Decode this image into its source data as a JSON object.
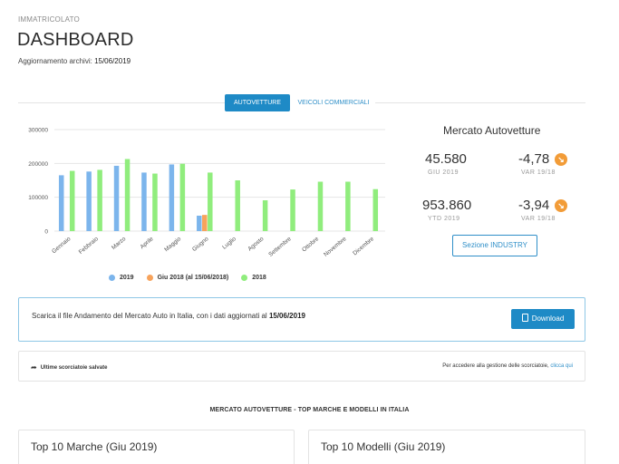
{
  "header": {
    "eyebrow": "IMMATRICOLATO",
    "title": "DASHBOARD",
    "updated_label": "Aggiornamento archivi:",
    "updated_date": "15/06/2019"
  },
  "tabs": [
    {
      "label": "AUTOVETTURE",
      "active": true
    },
    {
      "label": "VEICOLI COMMERCIALI",
      "active": false
    }
  ],
  "chart_data": {
    "type": "bar",
    "categories": [
      "Gennaio",
      "Febbraio",
      "Marzo",
      "Aprile",
      "Maggio",
      "Giugno",
      "Luglio",
      "Agosto",
      "Settembre",
      "Ottobre",
      "Novembre",
      "Dicembre"
    ],
    "yticks": [
      "0",
      "100000",
      "200000",
      "300000"
    ],
    "ylim": [
      0,
      300000
    ],
    "series": [
      {
        "name": "2019",
        "color": "#7cb5ec",
        "values": [
          165000,
          176000,
          193000,
          173000,
          197000,
          45580,
          null,
          null,
          null,
          null,
          null,
          null
        ]
      },
      {
        "name": "Giu 2018 (al 15/06/2018)",
        "color": "#f7a35c",
        "values": [
          null,
          null,
          null,
          null,
          null,
          47800,
          null,
          null,
          null,
          null,
          null,
          null
        ]
      },
      {
        "name": "2018",
        "color": "#90ed7d",
        "values": [
          178000,
          181000,
          213000,
          170000,
          199000,
          173000,
          150000,
          91000,
          123000,
          146000,
          146000,
          124000
        ]
      }
    ]
  },
  "market": {
    "title": "Mercato Autovetture",
    "month_value": "45.580",
    "month_label": "GIU 2019",
    "month_var": "-4,78",
    "month_var_label": "VAR 19/18",
    "ytd_value": "953.860",
    "ytd_label": "YTD 2019",
    "ytd_var": "-3,94",
    "ytd_var_label": "VAR 19/18",
    "arrow_color": "#f29c38",
    "arrow_glyph": "↘",
    "button_label": "Sezione INDUSTRY"
  },
  "download": {
    "text": "Scarica il file Andamento del Mercato Auto in Italia, con i dati aggiornati al",
    "date": "15/06/2019",
    "button_label": "Download",
    "icon": "file-pdf-icon"
  },
  "saved": {
    "icon": "share-icon",
    "left_label": "Ultime scorciatoie salvate",
    "right_text": "Per accedere alla gestione delle scorciatoie,",
    "right_link": "clicca qui"
  },
  "top_section": {
    "heading": "MERCATO AUTOVETTURE - TOP MARCHE E MODELLI IN ITALIA",
    "card_left": "Top 10 Marche (Giu 2019)",
    "card_right": "Top 10 Modelli (Giu 2019)"
  },
  "colors": {
    "accent": "#1e8ac6",
    "link": "#2f8fc8",
    "series_2019": "#7cb5ec",
    "series_giu2018": "#f7a35c",
    "series_2018": "#90ed7d"
  }
}
